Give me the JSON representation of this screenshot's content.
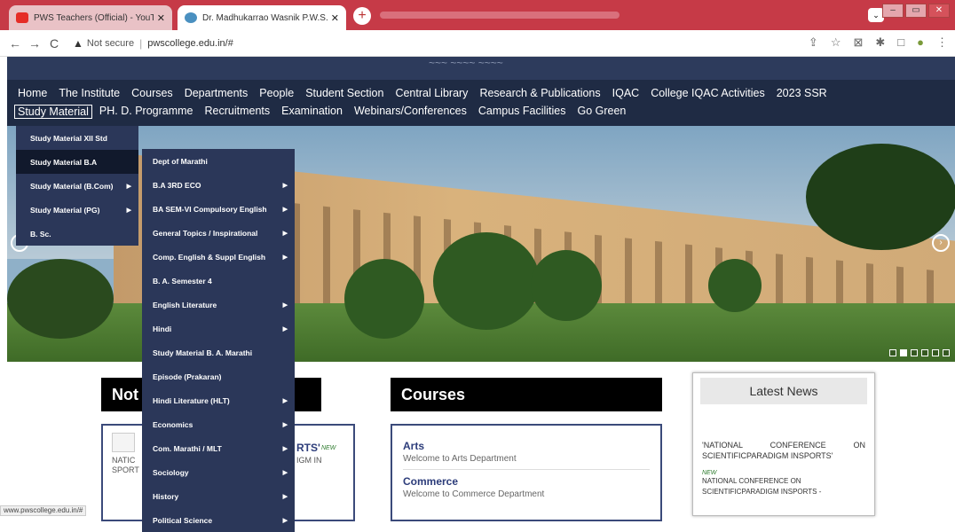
{
  "browser": {
    "tabs": [
      {
        "title": "PWS Teachers (Official) - YouTub",
        "favicon_color": "#e52d27"
      },
      {
        "title": "Dr. Madhukarrao Wasnik P.W.S.",
        "favicon_color": "#4a90c0"
      }
    ],
    "new_tab_label": "+",
    "security_label": "Not secure",
    "url": "pwscollege.edu.in/#",
    "status_url": "www.pwscollege.edu.in/#"
  },
  "site": {
    "top_faded": "~~~ ~~~~ ~~~~",
    "nav_row1": [
      "Home",
      "The Institute",
      "Courses",
      "Departments",
      "People",
      "Student Section",
      "Central Library",
      "Research & Publications",
      "IQAC",
      "College IQAC Activities",
      "2023 SSR"
    ],
    "nav_row2": [
      "Study Material",
      "PH. D. Programme",
      "Recruitments",
      "Examination",
      "Webinars/Conferences",
      "Campus Facilities",
      "Go Green"
    ]
  },
  "menu_level1": [
    {
      "label": "Study Material XII Std",
      "has_sub": false,
      "active": false
    },
    {
      "label": "Study Material B.A",
      "has_sub": false,
      "active": true
    },
    {
      "label": "Study Material (B.Com)",
      "has_sub": true,
      "active": false
    },
    {
      "label": "Study Material (PG)",
      "has_sub": true,
      "active": false
    },
    {
      "label": "B. Sc.",
      "has_sub": false,
      "active": false
    }
  ],
  "menu_level2": [
    {
      "label": "Dept of Marathi",
      "has_sub": false
    },
    {
      "label": "B.A 3RD ECO",
      "has_sub": true
    },
    {
      "label": "BA SEM-VI Compulsory English",
      "has_sub": true
    },
    {
      "label": "General Topics / Inspirational",
      "has_sub": true
    },
    {
      "label": "Comp. English & Suppl English",
      "has_sub": true
    },
    {
      "label": "B. A. Semester 4",
      "has_sub": false
    },
    {
      "label": "English Literature",
      "has_sub": true
    },
    {
      "label": "Hindi",
      "has_sub": true
    },
    {
      "label": "Study Material B. A. Marathi",
      "has_sub": false
    },
    {
      "label": "Episode (Prakaran)",
      "has_sub": false
    },
    {
      "label": "Hindi Literature (HLT)",
      "has_sub": true
    },
    {
      "label": "Economics",
      "has_sub": true
    },
    {
      "label": "Com. Marathi / MLT",
      "has_sub": true
    },
    {
      "label": "Sociology",
      "has_sub": true
    },
    {
      "label": "History",
      "has_sub": true
    },
    {
      "label": "Political Science",
      "has_sub": true
    }
  ],
  "notices": {
    "heading": "Not",
    "item_title_tail": "RTS'",
    "item_text_left": "NATIC\nSPORT",
    "item_text_right": "IGM IN"
  },
  "courses": {
    "heading": "Courses",
    "items": [
      {
        "title": "Arts",
        "subtitle": "Welcome to Arts Department"
      },
      {
        "title": "Commerce",
        "subtitle": "Welcome to Commerce Department"
      }
    ]
  },
  "news": {
    "heading": "Latest News",
    "item1": "'NATIONAL CONFERENCE ON SCIENTIFICPARADIGM INSPORTS'",
    "new_label": "NEW",
    "item2": "NATIONAL CONFERENCE ON SCIENTIFICPARADIGM INSPORTS -"
  },
  "colors": {
    "navbar": "#1f2b44",
    "menu": "#2b3759",
    "tabbar": "#c63a47"
  }
}
